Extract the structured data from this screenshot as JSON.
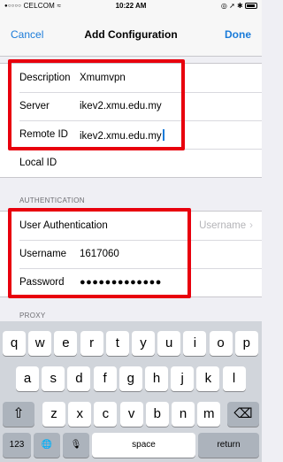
{
  "status_bar": {
    "signal_dots": "●○○○○",
    "carrier": "CELCOM",
    "wifi_glyph": "≈",
    "time": "10:22 AM",
    "icons": [
      "alarm-icon",
      "location-icon",
      "bluetooth-icon",
      "battery-icon"
    ],
    "right_glyphs": "◎ ➚ ✱"
  },
  "nav": {
    "cancel_label": "Cancel",
    "title": "Add Configuration",
    "done_label": "Done"
  },
  "connection": {
    "rows": [
      {
        "label": "Description",
        "value": "Xmumvpn"
      },
      {
        "label": "Server",
        "value": "ikev2.xmu.edu.my"
      },
      {
        "label": "Remote ID",
        "value": "ikev2.xmu.edu.my"
      },
      {
        "label": "Local ID",
        "value": ""
      }
    ]
  },
  "authentication": {
    "header": "AUTHENTICATION",
    "user_auth_label": "User Authentication",
    "user_auth_value": "Username",
    "username_label": "Username",
    "username_value": "1617060",
    "password_label": "Password",
    "password_value": "●●●●●●●●●●●●●"
  },
  "proxy": {
    "header": "PROXY"
  },
  "keyboard": {
    "row1": [
      "q",
      "w",
      "e",
      "r",
      "t",
      "y",
      "u",
      "i",
      "o",
      "p"
    ],
    "row2": [
      "a",
      "s",
      "d",
      "f",
      "g",
      "h",
      "j",
      "k",
      "l"
    ],
    "row3": [
      "z",
      "x",
      "c",
      "v",
      "b",
      "n",
      "m"
    ],
    "shift_glyph": "⇧",
    "delete_glyph": "⌫",
    "numbers_label": "123",
    "globe_glyph": "🌐",
    "mic_glyph": "🎙",
    "space_label": "space",
    "return_label": "return"
  },
  "colors": {
    "accent": "#1a7bd9",
    "highlight": "#e8000d",
    "keyboard_bg": "#d1d5db"
  }
}
